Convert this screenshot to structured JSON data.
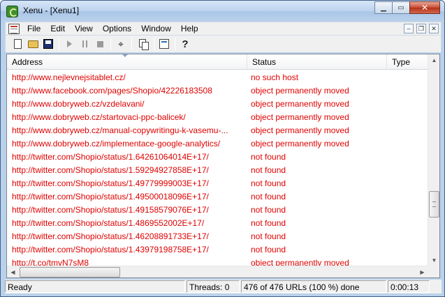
{
  "window": {
    "title": "Xenu - [Xenu1]"
  },
  "menu": {
    "items": [
      {
        "label": "File"
      },
      {
        "label": "Edit"
      },
      {
        "label": "View"
      },
      {
        "label": "Options"
      },
      {
        "label": "Window"
      },
      {
        "label": "Help"
      }
    ]
  },
  "toolbar": {
    "buttons": [
      "new-document-icon",
      "open-folder-icon",
      "save-icon",
      "play-icon",
      "pause-icon",
      "stop-icon",
      "find-icon",
      "copy-icon",
      "properties-icon",
      "help-icon"
    ]
  },
  "table": {
    "columns": {
      "address": "Address",
      "status": "Status",
      "type": "Type"
    },
    "link_color": "#e00000",
    "rows": [
      {
        "address": "http://www.nejlevnejsitablet.cz/",
        "status": "no such host",
        "type": ""
      },
      {
        "address": "http://www.facebook.com/pages/Shopio/42226183508",
        "status": "object permanently moved",
        "type": ""
      },
      {
        "address": "http://www.dobryweb.cz/vzdelavani/",
        "status": "object permanently moved",
        "type": ""
      },
      {
        "address": "http://www.dobryweb.cz/startovaci-ppc-balicek/",
        "status": "object permanently moved",
        "type": ""
      },
      {
        "address": "http://www.dobryweb.cz/manual-copywritingu-k-vasemu-...",
        "status": "object permanently moved",
        "type": ""
      },
      {
        "address": "http://www.dobryweb.cz/implementace-google-analytics/",
        "status": "object permanently moved",
        "type": ""
      },
      {
        "address": "http://twitter.com/Shopio/status/1.64261064014E+17/",
        "status": "not found",
        "type": ""
      },
      {
        "address": "http://twitter.com/Shopio/status/1.59294927858E+17/",
        "status": "not found",
        "type": ""
      },
      {
        "address": "http://twitter.com/Shopio/status/1.49779999003E+17/",
        "status": "not found",
        "type": ""
      },
      {
        "address": "http://twitter.com/Shopio/status/1.49500018096E+17/",
        "status": "not found",
        "type": ""
      },
      {
        "address": "http://twitter.com/Shopio/status/1.49158579076E+17/",
        "status": "not found",
        "type": ""
      },
      {
        "address": "http://twitter.com/Shopio/status/1.4869552002E+17/",
        "status": "not found",
        "type": ""
      },
      {
        "address": "http://twitter.com/Shopio/status/1.46208891733E+17/",
        "status": "not found",
        "type": ""
      },
      {
        "address": "http://twitter.com/Shopio/status/1.43979198758E+17/",
        "status": "not found",
        "type": ""
      },
      {
        "address": "http://t.co/tmvN7sM8",
        "status": "object permanently moved",
        "type": ""
      }
    ]
  },
  "statusbar": {
    "state": "Ready",
    "threads": "Threads: 0",
    "progress": "476 of 476 URLs (100 %) done",
    "elapsed": "0:00:13"
  }
}
